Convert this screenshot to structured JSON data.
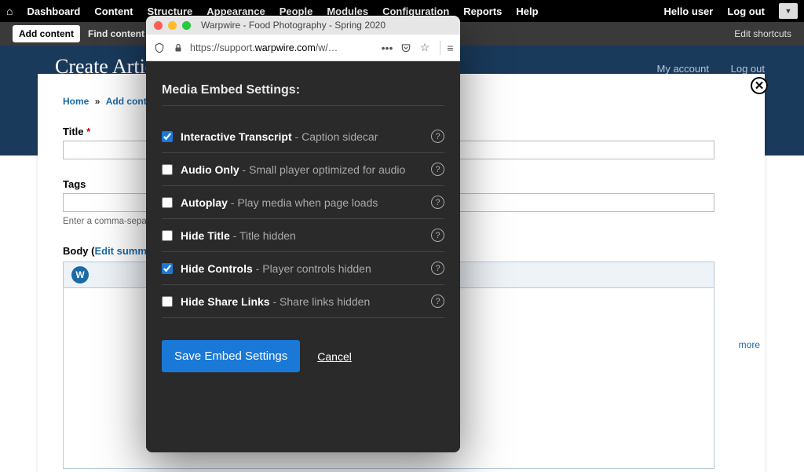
{
  "adminMenu": {
    "items": [
      "Dashboard",
      "Content",
      "Structure",
      "Appearance",
      "People",
      "Modules",
      "Configuration",
      "Reports",
      "Help"
    ],
    "greeting_prefix": "Hello ",
    "greeting_user": "user",
    "logout": "Log out"
  },
  "shortcutBar": {
    "addContent": "Add content",
    "findContent": "Find content",
    "editShortcuts": "Edit shortcuts"
  },
  "blueHeader": {
    "title": "Create Article",
    "myAccount": "My account",
    "logout": "Log out"
  },
  "breadcrumb": {
    "home": "Home",
    "addContent": "Add content"
  },
  "form": {
    "titleLabel": "Title",
    "tagsLabel": "Tags",
    "tagsDesc": "Enter a comma-separated list",
    "bodyLabel": "Body (",
    "editSummary": "Edit summary",
    "moreLink": "more"
  },
  "popup": {
    "windowTitle": "Warpwire - Food Photography - Spring 2020",
    "url_prefix": "https://support.",
    "url_domain": "warpwire.com",
    "url_suffix": "/w/…",
    "heading": "Media Embed Settings:",
    "options": [
      {
        "key": "interactive",
        "name": "Interactive Transcript",
        "desc": "Caption sidecar",
        "checked": true
      },
      {
        "key": "audio",
        "name": "Audio Only",
        "desc": "Small player optimized for audio",
        "checked": false
      },
      {
        "key": "autoplay",
        "name": "Autoplay",
        "desc": "Play media when page loads",
        "checked": false
      },
      {
        "key": "hidetitle",
        "name": "Hide Title",
        "desc": "Title hidden",
        "checked": false
      },
      {
        "key": "hidecontrols",
        "name": "Hide Controls",
        "desc": "Player controls hidden",
        "checked": true
      },
      {
        "key": "hideshare",
        "name": "Hide Share Links",
        "desc": "Share links hidden",
        "checked": false
      }
    ],
    "save": "Save Embed Settings",
    "cancel": "Cancel"
  }
}
